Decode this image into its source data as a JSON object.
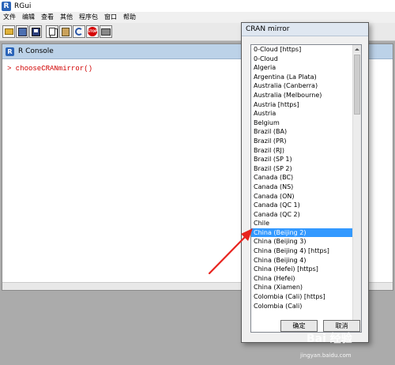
{
  "window": {
    "title": "RGui",
    "logo": "R"
  },
  "menu": {
    "items": [
      "文件",
      "编辑",
      "查看",
      "其他",
      "程序包",
      "窗口",
      "帮助"
    ]
  },
  "toolbar": {
    "icons": [
      "open-script-icon",
      "load-workspace-icon",
      "save-workspace-icon",
      "copy-icon",
      "paste-icon",
      "copy-paste-icon",
      "stop-icon",
      "print-icon"
    ],
    "stop_label": "STOP"
  },
  "console": {
    "title": "R Console",
    "logo": "R",
    "command": "> chooseCRANmirror()",
    "command_color": "#d00000"
  },
  "dialog": {
    "title": "CRAN mirror",
    "mirrors": [
      "0-Cloud [https]",
      "0-Cloud",
      "Algeria",
      "Argentina (La Plata)",
      "Australia (Canberra)",
      "Australia (Melbourne)",
      "Austria [https]",
      "Austria",
      "Belgium",
      "Brazil (BA)",
      "Brazil (PR)",
      "Brazil (RJ)",
      "Brazil (SP 1)",
      "Brazil (SP 2)",
      "Canada (BC)",
      "Canada (NS)",
      "Canada (ON)",
      "Canada (QC 1)",
      "Canada (QC 2)",
      "Chile",
      "China (Beijing 2)",
      "China (Beijing 3)",
      "China (Beijing 4) [https]",
      "China (Beijing 4)",
      "China (Hefei) [https]",
      "China (Hefei)",
      "China (Xiamen)",
      "Colombia (Cali) [https]",
      "Colombia (Cali)"
    ],
    "selected": "China (Beijing 2)",
    "ok_label": "确定",
    "cancel_label": "取消",
    "selection_color": "#3399ff"
  },
  "watermark": {
    "logo": "Bai 经验",
    "url": "jingyan.baidu.com"
  },
  "colors": {
    "annotation": "#e8231e",
    "console_header": "#bcd2e8",
    "background": "#ababab"
  }
}
